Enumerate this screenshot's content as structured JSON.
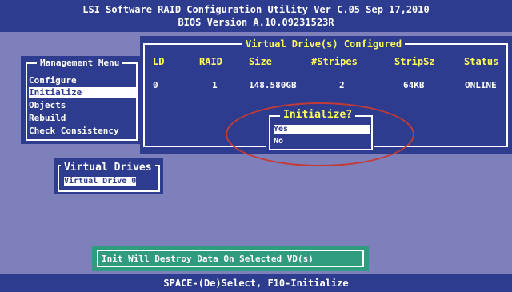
{
  "title": {
    "line1": "LSI Software RAID Configuration Utility Ver C.05 Sep 17,2010",
    "line2": "BIOS Version  A.10.09231523R"
  },
  "management_menu": {
    "title": "Management Menu",
    "items": [
      "Configure",
      "Initialize",
      "Objects",
      "Rebuild",
      "Check Consistency"
    ],
    "selected": "Initialize"
  },
  "virtual_drives_configured": {
    "title": "Virtual Drive(s) Configured",
    "headers": [
      "LD",
      "RAID",
      "Size",
      "#Stripes",
      "StripSz",
      "Status"
    ],
    "rows": [
      [
        "0",
        "1",
        "148.580GB",
        "2",
        "64KB",
        "ONLINE"
      ]
    ]
  },
  "initialize_dialog": {
    "title": "Initialize?",
    "options": [
      "Yes",
      "No"
    ],
    "selected": "Yes"
  },
  "virtual_drives": {
    "title": "Virtual Drives",
    "items": [
      "Virtual Drive 0"
    ]
  },
  "warning": "Init Will Destroy Data On Selected VD(s)",
  "status_bar": "SPACE-(De)Select,  F10-Initialize",
  "colors": {
    "background": "#7e80bc",
    "panel": "#2d3c8e",
    "header_text": "#ffff55",
    "warning_box": "#2f9b7f",
    "highlight_ellipse": "#c33b36"
  }
}
